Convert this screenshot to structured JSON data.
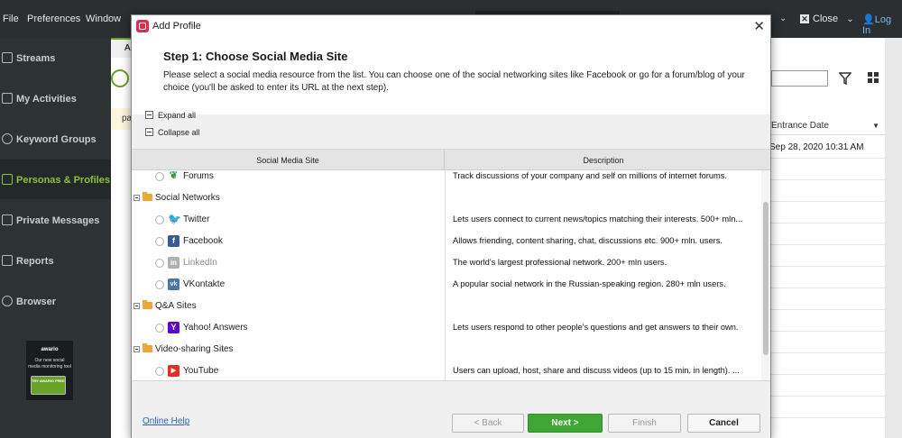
{
  "menubar": {
    "file": "File",
    "preferences": "Preferences",
    "window": "Window",
    "close": "Close",
    "login": "Log In"
  },
  "sidebar": {
    "items": [
      {
        "label": "Streams",
        "icon": "streams-icon"
      },
      {
        "label": "My Activities",
        "icon": "activities-icon"
      },
      {
        "label": "Keyword Groups",
        "icon": "keyword-icon"
      },
      {
        "label": "Personas & Profiles",
        "icon": "personas-icon"
      },
      {
        "label": "Private Messages",
        "icon": "messages-icon"
      },
      {
        "label": "Reports",
        "icon": "reports-icon"
      },
      {
        "label": "Browser",
        "icon": "globe-icon"
      }
    ],
    "promo": {
      "logo": "awario",
      "text": "Our new social media monitoring tool",
      "button": "TRY AWARIO FREE"
    }
  },
  "background": {
    "tab_fragment": "A",
    "banner_fragment": "pa",
    "column_header": "Entrance Date",
    "date_cell": "Sep 28, 2020 10:31 AM"
  },
  "dialog": {
    "title": "Add Profile",
    "step_title": "Step 1: Choose Social Media Site",
    "step_description": "Please select a social media resource from the list. You can choose one of the social networking sites like Facebook or go for a forum/blog of your choice (you'll be asked to enter its URL at the next step).",
    "expand_all": "Expand all",
    "collapse_all": "Collapse all",
    "columns": {
      "site": "Social Media Site",
      "description": "Description"
    },
    "rows": {
      "forums": {
        "name": "Forums",
        "desc": "Track discussions of your company and self on millions of internet forums."
      },
      "social_networks": "Social Networks",
      "twitter": {
        "name": "Twitter",
        "desc": "Lets users connect to current news/topics matching their interests. 500+ mln..."
      },
      "facebook": {
        "name": "Facebook",
        "desc": "Allows friending, content sharing, chat, discussions etc. 900+ mln. users."
      },
      "linkedin": {
        "name": "LinkedIn",
        "desc": "The world's largest professional network. 200+ mln users."
      },
      "vkontakte": {
        "name": "VKontakte",
        "desc": "A popular social network in the Russian-speaking region. 280+ mln users."
      },
      "qa_sites": "Q&A Sites",
      "yahoo": {
        "name": "Yahoo! Answers",
        "desc": "Lets users respond to other people's questions and get answers to their own."
      },
      "video_sites": "Video-sharing Sites",
      "youtube": {
        "name": "YouTube",
        "desc": "Users can upload, host, share and discuss videos (up to 15 min. in length). ..."
      }
    },
    "footer": {
      "online_help": "Online Help",
      "back": "< Back",
      "next": "Next >",
      "finish": "Finish",
      "cancel": "Cancel"
    }
  },
  "colors": {
    "accent_green": "#6aa229",
    "next_button": "#3fa535",
    "app_icon": "#d9304f",
    "link": "#2a64b8"
  }
}
